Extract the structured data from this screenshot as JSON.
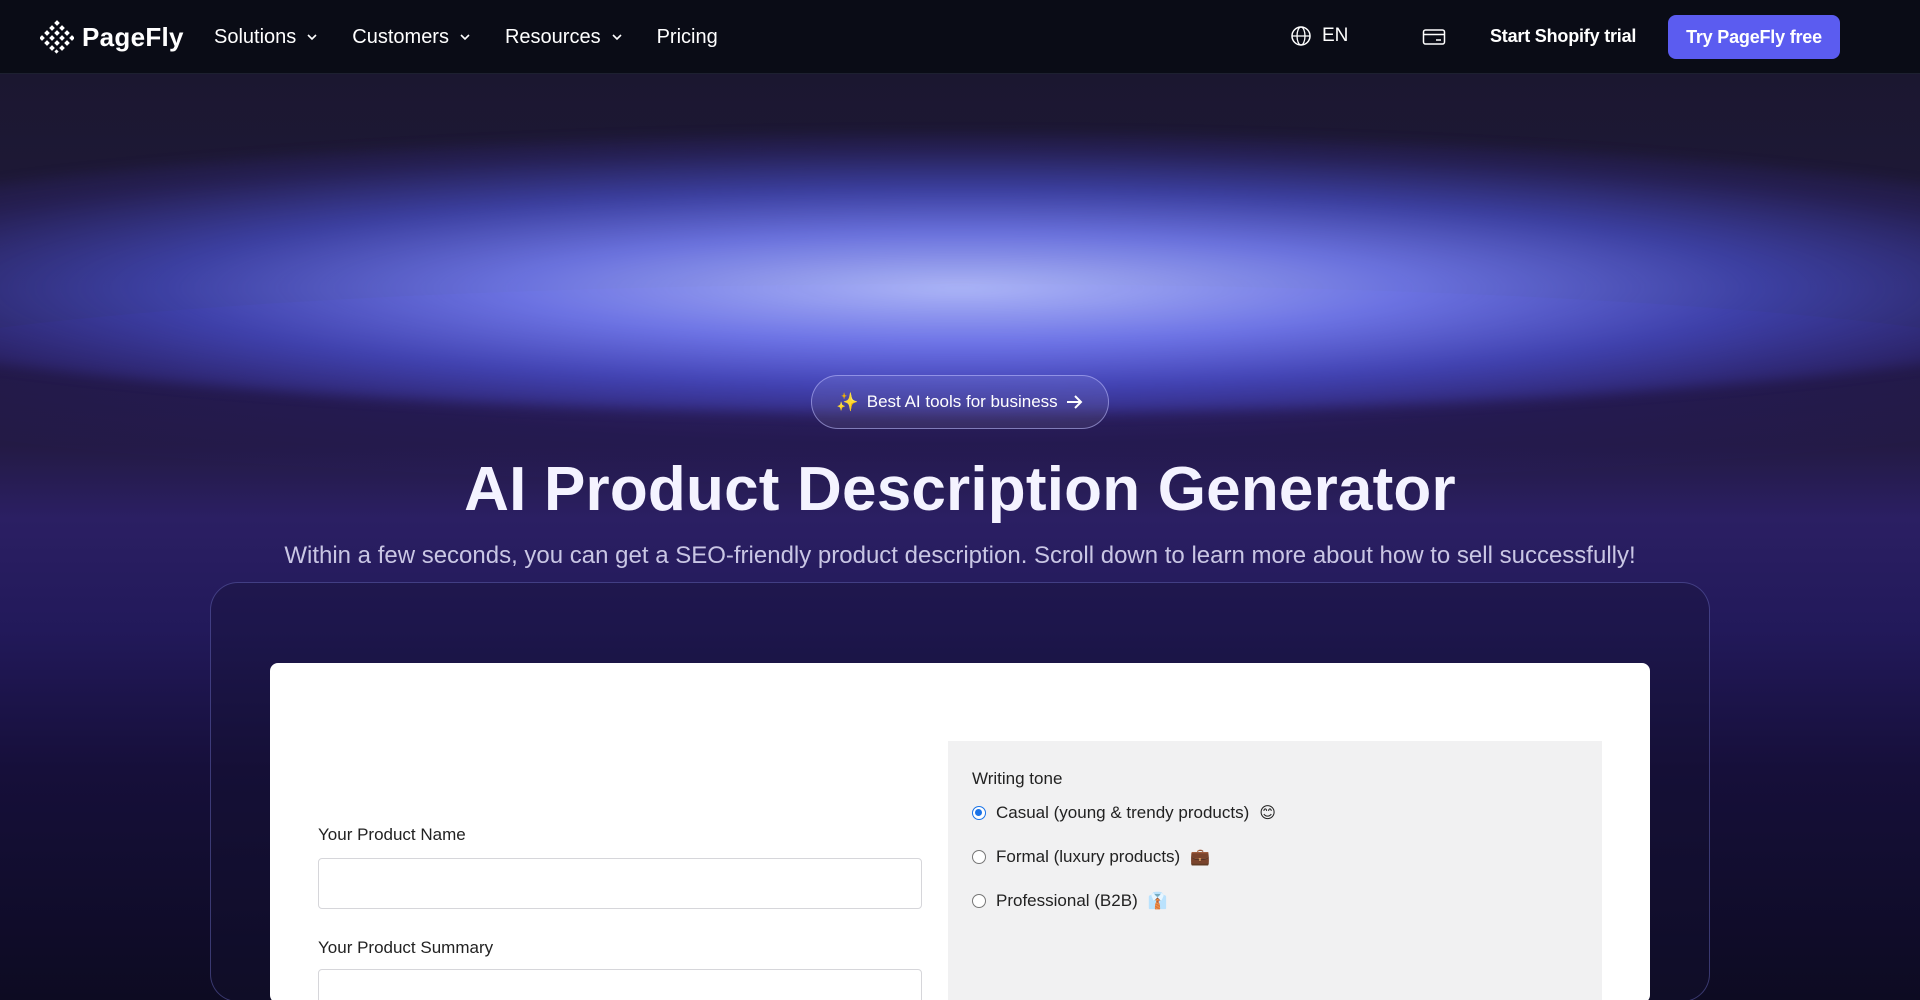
{
  "nav": {
    "logo_text": "PageFly",
    "links": [
      {
        "label": "Solutions",
        "has_dropdown": true
      },
      {
        "label": "Customers",
        "has_dropdown": true
      },
      {
        "label": "Resources",
        "has_dropdown": true
      },
      {
        "label": "Pricing",
        "has_dropdown": false
      }
    ],
    "language": "EN",
    "start_trial_label": "Start Shopify trial",
    "try_free_label": "Try PageFly free"
  },
  "hero": {
    "badge_label": "Best AI tools for business",
    "title": "AI Product Description Generator",
    "subtitle": "Within a few seconds, you can get a SEO-friendly product description. Scroll down to learn more about how to sell successfully!"
  },
  "form": {
    "product_name_label": "Your Product Name",
    "product_name_value": "",
    "product_summary_label": "Your Product Summary",
    "product_summary_value": "",
    "writing_tone": {
      "label": "Writing tone",
      "options": [
        {
          "label": "Casual (young & trendy products)",
          "emoji": "😊",
          "checked": true
        },
        {
          "label": "Formal (luxury products)",
          "emoji": "💼",
          "checked": false
        },
        {
          "label": "Professional (B2B)",
          "emoji": "👔",
          "checked": false
        }
      ]
    }
  },
  "colors": {
    "accent": "#5b5cf0",
    "nav_bg": "#0a0c16",
    "radio_checked": "#1a73e8"
  }
}
